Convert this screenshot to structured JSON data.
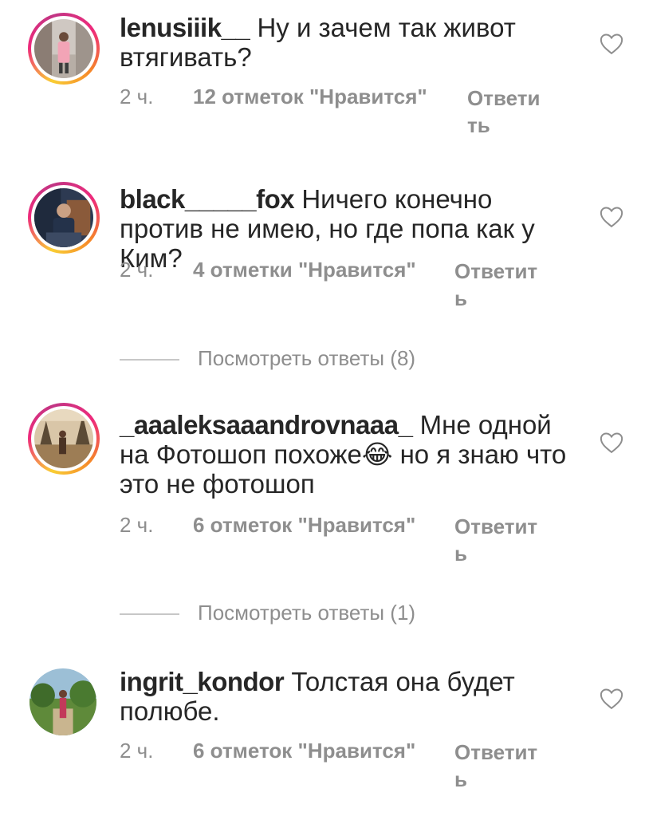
{
  "comments": [
    {
      "username": "lenusiiik__",
      "text": "Ну и зачем так живот втягивать?",
      "time": "2 ч.",
      "likes": "12 отметок \"Нравится\"",
      "reply": "Ответить",
      "has_story_ring": true,
      "heart_icon": "heart-outline-icon"
    },
    {
      "username": "black_____fox",
      "text": "Ничего конечно против не имею, но где попа как у Ким?",
      "time": "2 ч.",
      "likes": "4 отметки \"Нравится\"",
      "reply": "Ответить",
      "has_story_ring": true,
      "heart_icon": "heart-outline-icon",
      "view_replies": "Посмотреть ответы (8)"
    },
    {
      "username": "_aaaleksaaandrovnaaa_",
      "text": "Мне одной на Фотошоп похоже",
      "emoji": "😂",
      "text_after_emoji": "но я знаю что это не фотошоп",
      "time": "2 ч.",
      "likes": "6 отметок \"Нравится\"",
      "reply": "Ответить",
      "has_story_ring": true,
      "heart_icon": "heart-outline-icon",
      "view_replies": "Посмотреть ответы (1)"
    },
    {
      "username": "ingrit_kondor",
      "text": "Толстая она будет полюбе.",
      "time": "2 ч.",
      "likes": "6 отметок \"Нравится\"",
      "reply": "Ответить",
      "has_story_ring": false,
      "heart_icon": "heart-outline-icon"
    }
  ],
  "colors": {
    "text": "#262626",
    "secondary": "#8e8e8e",
    "divider": "#c7c7c7",
    "ring_start": "#f9ce34",
    "ring_mid": "#ee2a7b",
    "ring_end": "#c13584"
  }
}
